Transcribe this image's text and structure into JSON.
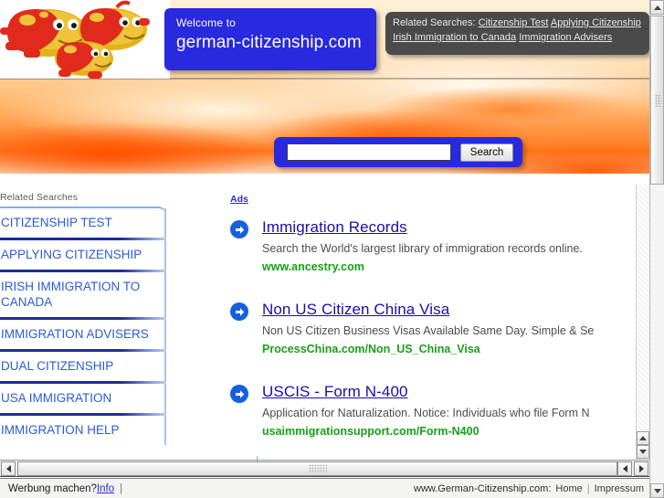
{
  "header": {
    "welcome_small": "Welcome to",
    "welcome_big": "german-citizenship.com"
  },
  "related_bubble": {
    "label": "Related Searches:",
    "links": [
      "Citizenship Test",
      "Applying Citizenship",
      "Irish Immigration to Canada",
      "Immigration Advisers"
    ]
  },
  "search": {
    "value": "",
    "placeholder": "",
    "button_label": "Search"
  },
  "sidebar": {
    "title": "Related Searches",
    "items": [
      {
        "label": "CITIZENSHIP TEST"
      },
      {
        "label": "APPLYING CITIZENSHIP"
      },
      {
        "label": "IRISH IMMIGRATION TO CANADA"
      },
      {
        "label": "IMMIGRATION ADVISERS"
      },
      {
        "label": "DUAL CITIZENSHIP"
      },
      {
        "label": "USA IMMIGRATION"
      },
      {
        "label": "IMMIGRATION HELP"
      }
    ]
  },
  "ads": {
    "label": "Ads",
    "items": [
      {
        "title": "Immigration Records",
        "description": "Search the World's largest library of immigration records online.",
        "url": "www.ancestry.com"
      },
      {
        "title": "Non US Citizen China Visa",
        "description": "Non US Citizen Business Visas Available Same Day. Simple & Se",
        "url": "ProcessChina.com/Non_US_China_Visa"
      },
      {
        "title": "USCIS - Form N-400",
        "description": "Application for Naturalization. Notice: Individuals who file Form N",
        "url": "usaimmigrationsupport.com/Form-N400"
      }
    ]
  },
  "statusbar": {
    "advertise_text": "Werbung machen?",
    "info_label": "Info",
    "separator": "|",
    "site_label": "www.German-Citizenship.com:",
    "home_label": "Home",
    "pipe": "|",
    "impressum_label": "Impressum"
  },
  "colors": {
    "brand_blue": "#2929e0",
    "link_blue": "#1a0dab",
    "url_green": "#18a018",
    "sidebar_rule": "#1a2d9c",
    "bubble_gray": "#4a4a4a"
  }
}
